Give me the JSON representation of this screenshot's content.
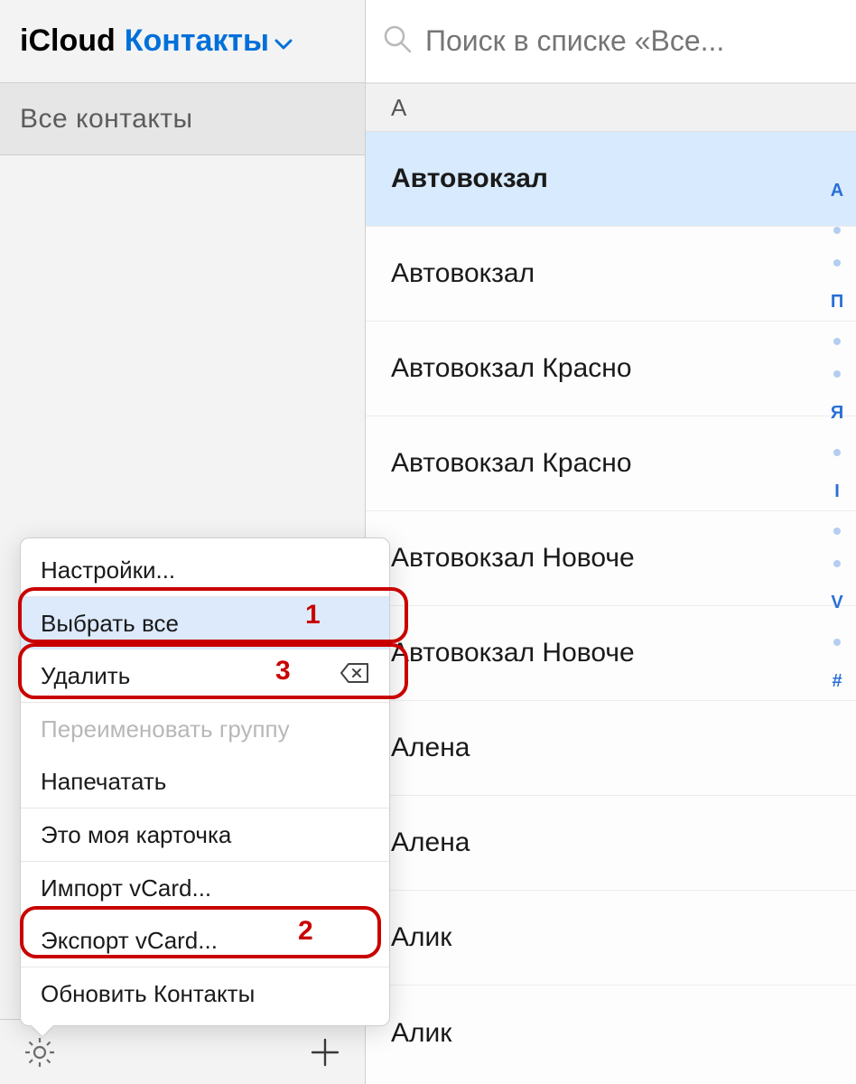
{
  "header": {
    "brand": "iCloud",
    "dropdown_label": "Контакты"
  },
  "sidebar": {
    "all_contacts_label": "Все контакты"
  },
  "search": {
    "placeholder": "Поиск в списке «Все..."
  },
  "section_letter": "А",
  "contacts": [
    {
      "name": "Автовокзал",
      "selected": true
    },
    {
      "name": "Автовокзал"
    },
    {
      "name": "Автовокзал Красно"
    },
    {
      "name": "Автовокзал Красно"
    },
    {
      "name": "Автовокзал Новоче"
    },
    {
      "name": "Автовокзал Новоче"
    },
    {
      "name": "Алена"
    },
    {
      "name": "Алена"
    },
    {
      "name": "Алик"
    },
    {
      "name": "Алик"
    }
  ],
  "index_rail": [
    "А",
    ".",
    ".",
    "П",
    ".",
    ".",
    "Я",
    ".",
    "I",
    ".",
    ".",
    "V",
    ".",
    "#"
  ],
  "menu": {
    "items": [
      {
        "label": "Настройки..."
      },
      {
        "label": "Выбрать все",
        "selected": true,
        "annotation": "1"
      },
      {
        "label": "Удалить",
        "shortcut_icon": "backspace",
        "annotation": "3"
      },
      {
        "label": "Переименовать группу",
        "disabled": true
      },
      {
        "label": "Напечатать"
      },
      {
        "label": "Это моя карточка"
      },
      {
        "label": "Импорт vCard..."
      },
      {
        "label": "Экспорт vCard...",
        "annotation": "2"
      },
      {
        "label": "Обновить Контакты"
      }
    ]
  },
  "annotations": {
    "a1": "1",
    "a2": "2",
    "a3": "3"
  }
}
